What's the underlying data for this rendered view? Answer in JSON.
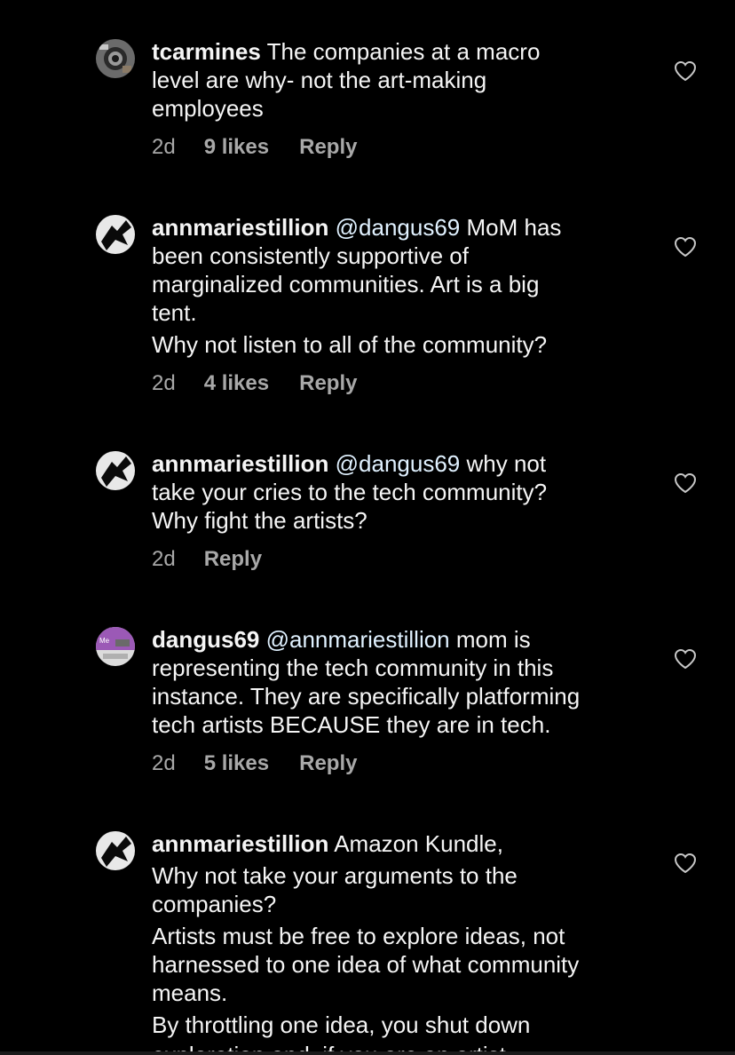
{
  "comments": [
    {
      "username": "tcarmines",
      "mention": "",
      "lines": [
        "The companies at a macro",
        "level are why- not the art-making",
        "employees"
      ],
      "time": "2d",
      "likes": "9 likes",
      "reply": "Reply"
    },
    {
      "username": "annmariestillion",
      "mention": "@dangus69",
      "lines": [
        "MoM has",
        "been consistently supportive of",
        "marginalized communities. Art is a big",
        "tent.",
        "Why not listen to all of the community?"
      ],
      "time": "2d",
      "likes": "4 likes",
      "reply": "Reply"
    },
    {
      "username": "annmariestillion",
      "mention": "@dangus69",
      "lines": [
        "why not",
        "take your cries to the tech community?",
        "Why fight the artists?"
      ],
      "time": "2d",
      "likes": "",
      "reply": "Reply"
    },
    {
      "username": "dangus69",
      "mention": "@annmariestillion",
      "lines": [
        "mom is",
        "representing the tech community in this",
        "instance. They are specifically platforming",
        "tech artists BECAUSE they are in tech."
      ],
      "time": "2d",
      "likes": "5 likes",
      "reply": "Reply"
    },
    {
      "username": "annmariestillion",
      "mention": "",
      "lines": [
        "Amazon Kundle,",
        "Why not take your arguments to the",
        "companies?",
        "Artists must be free to explore ideas, not",
        "harnessed to one idea of what community",
        "means.",
        "By throttling one idea, you shut down"
      ],
      "cut_line": "exploration and, if you are an artist,",
      "time": "",
      "likes": "",
      "reply": ""
    }
  ],
  "colors": {
    "background": "#000000",
    "text": "#f5f5f5",
    "meta": "#a8a8a8",
    "mention": "#e0f1ff"
  },
  "icons": {
    "like": "heart-outline-icon"
  }
}
